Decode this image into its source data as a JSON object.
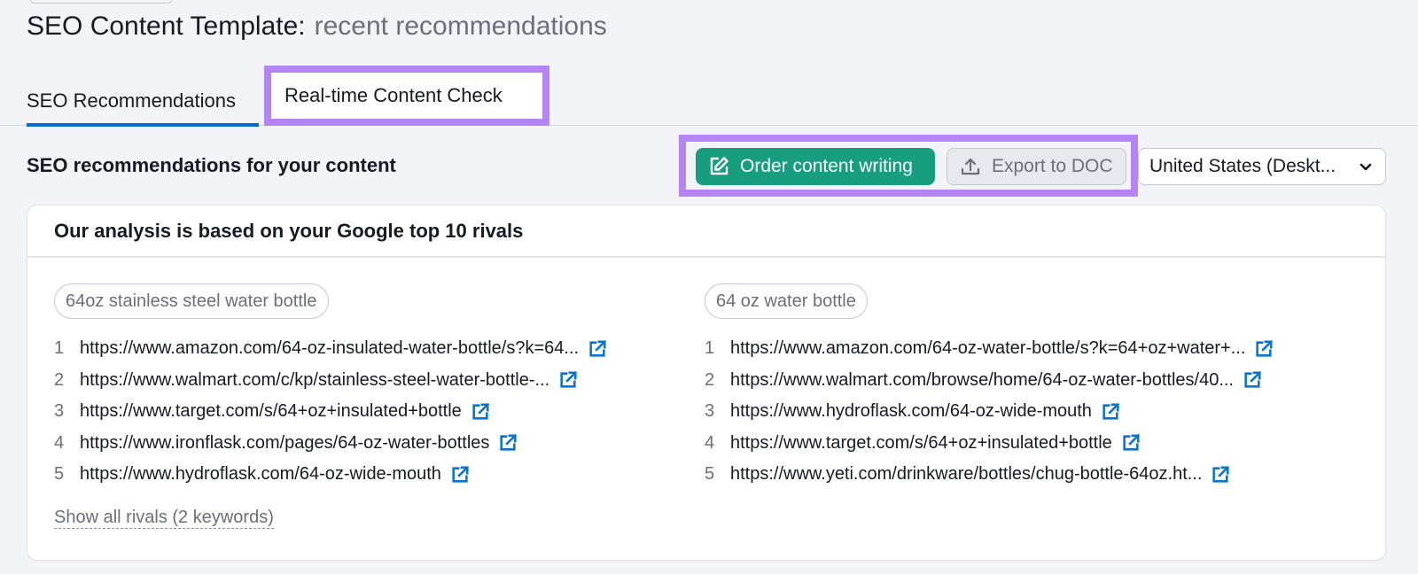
{
  "page": {
    "title": "SEO Content Template:",
    "subtitle": "recent recommendations"
  },
  "tabs": [
    {
      "label": "SEO Recommendations",
      "active": true
    },
    {
      "label": "Real-time Content Check",
      "active": false,
      "highlighted": true
    }
  ],
  "toolbar": {
    "title": "SEO recommendations for your content",
    "order_button": {
      "label": "Order content writing",
      "icon": "edit-icon"
    },
    "export_button": {
      "label": "Export to DOC",
      "icon": "upload-icon"
    },
    "location_select": {
      "value": "United States (Deskt...",
      "icon": "chevron-down-icon"
    }
  },
  "card": {
    "title": "Our analysis is based on your Google top 10 rivals",
    "keywords": [
      {
        "keyword": "64oz stainless steel water bottle",
        "urls": [
          {
            "rank": "1",
            "url": "https://www.amazon.com/64-oz-insulated-water-bottle/s?k=64..."
          },
          {
            "rank": "2",
            "url": "https://www.walmart.com/c/kp/stainless-steel-water-bottle-..."
          },
          {
            "rank": "3",
            "url": "https://www.target.com/s/64+oz+insulated+bottle"
          },
          {
            "rank": "4",
            "url": "https://www.ironflask.com/pages/64-oz-water-bottles"
          },
          {
            "rank": "5",
            "url": "https://www.hydroflask.com/64-oz-wide-mouth"
          }
        ]
      },
      {
        "keyword": "64 oz water bottle",
        "urls": [
          {
            "rank": "1",
            "url": "https://www.amazon.com/64-oz-water-bottle/s?k=64+oz+water+..."
          },
          {
            "rank": "2",
            "url": "https://www.walmart.com/browse/home/64-oz-water-bottles/40..."
          },
          {
            "rank": "3",
            "url": "https://www.hydroflask.com/64-oz-wide-mouth"
          },
          {
            "rank": "4",
            "url": "https://www.target.com/s/64+oz+insulated+bottle"
          },
          {
            "rank": "5",
            "url": "https://www.yeti.com/drinkware/bottles/chug-bottle-64oz.ht..."
          }
        ]
      }
    ],
    "show_all_label": "Show all rivals (2 keywords)"
  },
  "colors": {
    "accent_green": "#179e7e",
    "tab_underline": "#006dca",
    "highlight_purple": "#b584f7",
    "link_icon_blue": "#0a74d0"
  }
}
